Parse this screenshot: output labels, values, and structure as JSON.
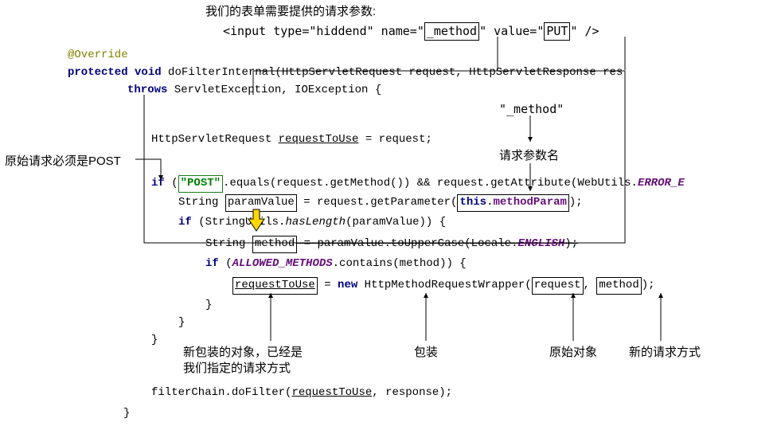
{
  "header": {
    "form_note": "我们的表单需要提供的请求参数:",
    "input_tag_prefix": "<input type=\"hiddend\" name=\"",
    "input_method": "_method",
    "input_tag_mid": "\" value=\"",
    "input_put": "PUT",
    "input_tag_suffix": "\" />"
  },
  "labels": {
    "must_post": "原始请求必须是POST",
    "method_txt": "\"_method\"",
    "param_name": "请求参数名",
    "wrapped_obj_1": "新包装的对象，已经是",
    "wrapped_obj_2": "我们指定的请求方式",
    "wrap": "包装",
    "orig_obj": "原始对象",
    "new_method": "新的请求方式"
  },
  "code": {
    "override": "@Override",
    "protected": "protected",
    "void": "void",
    "doFilter": " doFilterInternal(HttpServletRequest reque",
    "doFilter2": "t, HttpServletResponse res",
    "throws": "throws",
    "throws_rest": " ServletException, IOException {",
    "line1_a": "HttpServletReque",
    "line1_b": "t ",
    "line1_c": "requestToUse",
    "line1_d": " = request;",
    "s_char": "s",
    "if": "if",
    "post": "\"POST\"",
    "eq_rest": ".equal",
    "eq_rest2": "(request.getMethod()) && request.getAttribute(WebUtils.",
    "error_e": "ERROR_E",
    "str_pv": "String ",
    "paramValue": "paramValue",
    "pv_rest": " = request.getParameter(",
    "this_mp": "this.methodParam",
    "pv_end": ");",
    "if2_pre": " (StringUti",
    "if2_rest": ".",
    "hasLength": "hasLength",
    "if2_tail": "(paramValue)) {",
    "str_m": "String ",
    "method_txt": "method",
    "m_rest": " = paramValue.toUpperCase(Locale.",
    "english": "ENGLISH",
    "m_end": ");",
    "if3_pre": " (",
    "allowed": "ALLOWED_METHODS",
    "if3_rest": ".contains(method)) {",
    "rtu": "requestToUse",
    "eq_sp": " = ",
    "new": "new",
    "wrapper": " HttpMethodRequestWrapper(",
    "request_txt": "request",
    "comma_sp": ", ",
    "method2": "method",
    "wr_end": ");",
    "brace": "}",
    "chain": "filterChain.doFilter(",
    "chain_r": "requestToUse",
    "chain_end": ", response);"
  }
}
